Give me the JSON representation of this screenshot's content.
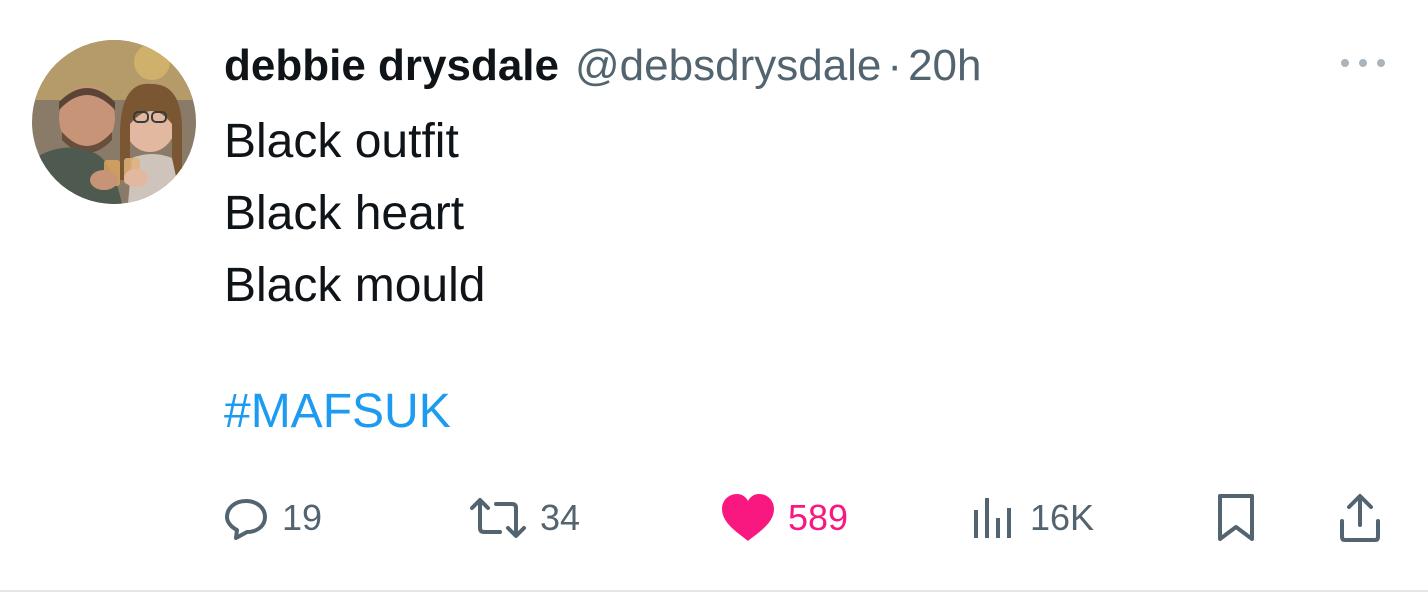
{
  "tweet": {
    "author_name": "debbie drysdale",
    "handle": "@debsdrysdale",
    "separator": "·",
    "time": "20h",
    "lines": [
      "Black outfit",
      "Black heart",
      "Black mould"
    ],
    "hashtag": "#MAFSUK"
  },
  "actions": {
    "replies": "19",
    "reposts": "34",
    "likes": "589",
    "views": "16K"
  },
  "colors": {
    "text": "#0f1419",
    "secondary": "#536471",
    "link": "#1d9bf0",
    "like": "#f91880"
  },
  "icons": {
    "more": "more-options-icon",
    "reply": "reply-icon",
    "repost": "repost-icon",
    "like": "heart-icon",
    "views": "views-chart-icon",
    "bookmark": "bookmark-icon",
    "share": "share-icon"
  }
}
